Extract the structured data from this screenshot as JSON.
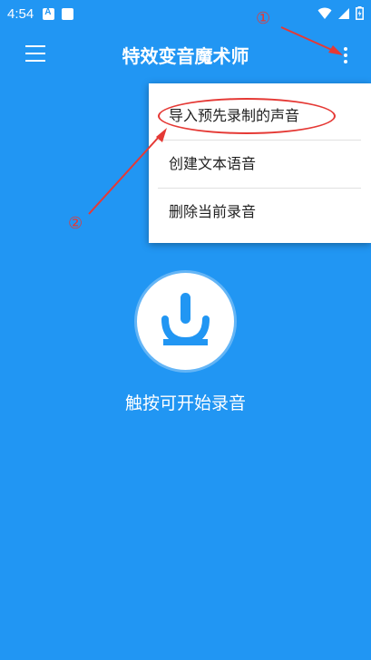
{
  "status_bar": {
    "time": "4:54"
  },
  "app_bar": {
    "title": "特效变音魔术师"
  },
  "menu": {
    "items": [
      {
        "label": "导入预先录制的声音"
      },
      {
        "label": "创建文本语音"
      },
      {
        "label": "删除当前录音"
      }
    ]
  },
  "annotations": {
    "marker_1": "①",
    "marker_2": "②"
  },
  "main": {
    "record_hint": "触按可开始录音"
  },
  "colors": {
    "background": "#2196F3",
    "annotation": "#e53935"
  }
}
